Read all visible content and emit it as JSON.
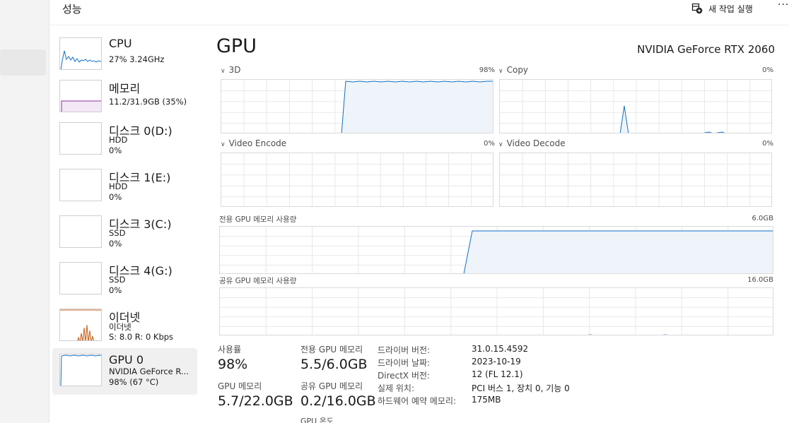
{
  "header": {
    "title": "성능",
    "new_task_label": "새 작업 실행",
    "more_label": "···"
  },
  "sidebar": {
    "items": [
      {
        "name": "CPU",
        "line1": "27% 3.24GHz",
        "line2": ""
      },
      {
        "name": "메모리",
        "line1": "11.2/31.9GB (35%)",
        "line2": ""
      },
      {
        "name": "디스크 0(D:)",
        "line1": "HDD",
        "line2": "0%"
      },
      {
        "name": "디스크 1(E:)",
        "line1": "HDD",
        "line2": "0%"
      },
      {
        "name": "디스크 3(C:)",
        "line1": "SSD",
        "line2": "0%"
      },
      {
        "name": "디스크 4(G:)",
        "line1": "SSD",
        "line2": "0%"
      },
      {
        "name": "이더넷",
        "line1": "이더넷",
        "line2": "S: 8.0  R: 0 Kbps"
      },
      {
        "name": "GPU 0",
        "line1": "NVIDIA GeForce R...",
        "line2": "98% (67 °C)"
      }
    ]
  },
  "main": {
    "title": "GPU",
    "model": "NVIDIA GeForce RTX 2060",
    "engines": [
      {
        "label": "3D",
        "percent": "98%",
        "current_value": 98
      },
      {
        "label": "Copy",
        "percent": "0%",
        "current_value": 0
      },
      {
        "label": "Video Encode",
        "percent": "0%",
        "current_value": 0
      },
      {
        "label": "Video Decode",
        "percent": "0%",
        "current_value": 0
      }
    ],
    "memory_graphs": [
      {
        "label": "전용 GPU 메모리 사용량",
        "max": "6.0GB"
      },
      {
        "label": "공유 GPU 메모리 사용량",
        "max": "16.0GB"
      }
    ],
    "stats": {
      "utilization_label": "사용률",
      "utilization_value": "98%",
      "dedicated_label": "전용 GPU 메모리",
      "dedicated_value": "5.5/6.0GB",
      "gpu_memory_label": "GPU 메모리",
      "gpu_memory_value": "5.7/22.0GB",
      "shared_label": "공유 GPU 메모리",
      "shared_value": "0.2/16.0GB",
      "temp_label": "GPU 온도"
    },
    "info": [
      {
        "label": "드라이버 버전:",
        "value": "31.0.15.4592"
      },
      {
        "label": "드라이버 날짜:",
        "value": "2023-10-19"
      },
      {
        "label": "DirectX 버전:",
        "value": "12 (FL 12.1)"
      },
      {
        "label": "실제 위치:",
        "value": "PCI 버스 1, 장치 0, 기능 0"
      },
      {
        "label": "하드웨어 예약 메모리:",
        "value": "175MB"
      }
    ]
  },
  "colors": {
    "cpu": "#1170c4",
    "memory": "#8b2f9e",
    "disk": "#4caf50",
    "ethernet": "#c7641d",
    "gpu": "#1170c4",
    "gpu_fill": "#eef4fa"
  },
  "icons": {
    "new_task": "new-task-icon",
    "chevron": "chevron-down-icon"
  }
}
